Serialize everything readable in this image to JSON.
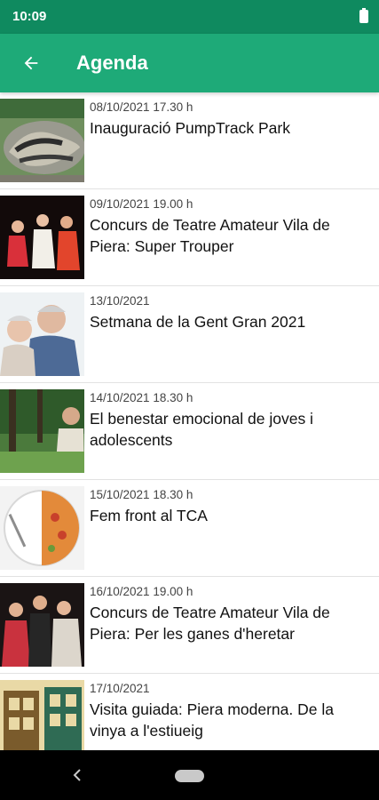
{
  "status_bar": {
    "time": "10:09",
    "battery_icon": "battery-full-icon"
  },
  "app_bar": {
    "back_icon": "arrow-back-icon",
    "title": "Agenda"
  },
  "events": [
    {
      "date": "08/10/2021 17.30 h",
      "title": "Inauguració PumpTrack Park",
      "image": "pumptrack-park-photo"
    },
    {
      "date": "09/10/2021 19.00 h",
      "title": "Concurs de Teatre Amateur Vila de Piera: Super Trouper",
      "image": "theatre-dancers-photo"
    },
    {
      "date": "13/10/2021",
      "title": "Setmana de la Gent Gran 2021",
      "image": "elderly-couple-photo"
    },
    {
      "date": "14/10/2021 18.30 h",
      "title": "El benestar emocional de joves i adolescents",
      "image": "youth-outdoors-photo"
    },
    {
      "date": "15/10/2021 18.30 h",
      "title": "Fem front al TCA",
      "image": "plate-pizza-photo"
    },
    {
      "date": "16/10/2021 19.00 h",
      "title": "Concurs de Teatre Amateur Vila de Piera: Per les ganes d'heretar",
      "image": "theatre-actors-photo"
    },
    {
      "date": "17/10/2021",
      "title": "Visita guiada: Piera moderna. De la vinya a l'estiueig",
      "image": "modernist-facade-illustration"
    }
  ],
  "nav_bar": {
    "back_icon": "nav-back-icon",
    "home_icon": "nav-home-pill"
  },
  "colors": {
    "status_bar": "#0f8a5f",
    "app_bar": "#1eaa78",
    "divider": "#e2e2e2",
    "nav_bar": "#000000"
  }
}
